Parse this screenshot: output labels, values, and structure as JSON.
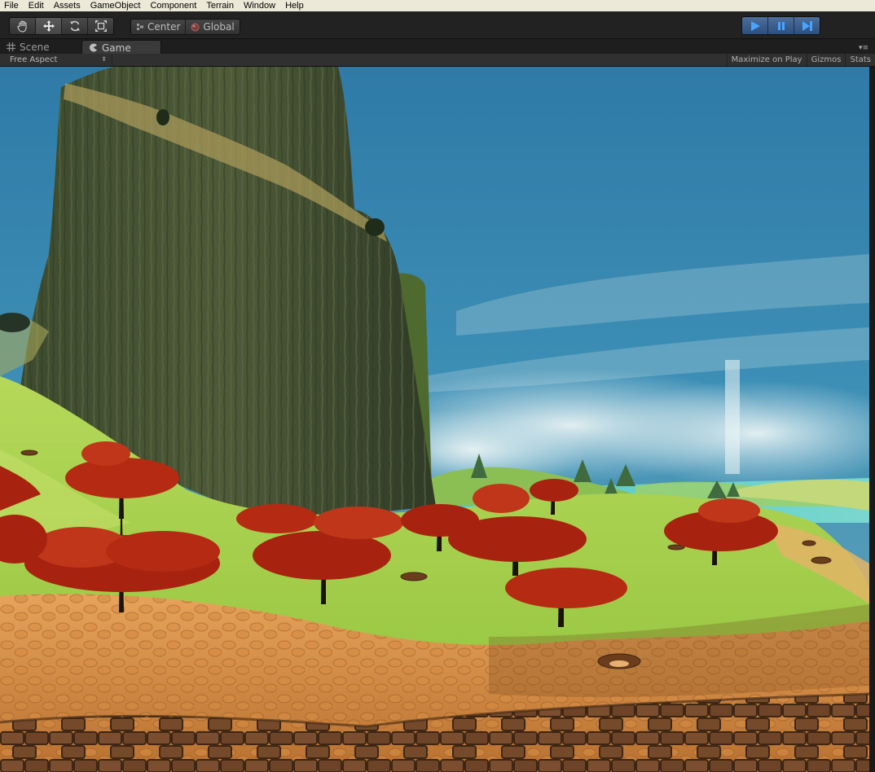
{
  "menu": [
    "File",
    "Edit",
    "Assets",
    "GameObject",
    "Component",
    "Terrain",
    "Window",
    "Help"
  ],
  "toolbar": {
    "transform_tools": [
      {
        "name": "hand-tool",
        "icon": "hand-icon"
      },
      {
        "name": "move-tool",
        "icon": "move-arrows-icon",
        "active": true
      },
      {
        "name": "rotate-tool",
        "icon": "rotate-icon"
      },
      {
        "name": "scale-tool",
        "icon": "scale-icon"
      }
    ],
    "pivot_label": "Center",
    "space_label": "Global",
    "play_controls": [
      {
        "name": "play-button",
        "icon": "play-icon"
      },
      {
        "name": "pause-button",
        "icon": "pause-icon"
      },
      {
        "name": "step-button",
        "icon": "step-icon"
      }
    ],
    "accent_color": "#3b6ea5"
  },
  "tabs": [
    {
      "label": "Scene",
      "icon": "grid-icon",
      "active": false
    },
    {
      "label": "Game",
      "icon": "pacman-icon",
      "active": true
    }
  ],
  "game_toolbar": {
    "aspect": "Free Aspect",
    "maximize_on_play": "Maximize on Play",
    "gizmos": "Gizmos",
    "stats": "Stats"
  }
}
